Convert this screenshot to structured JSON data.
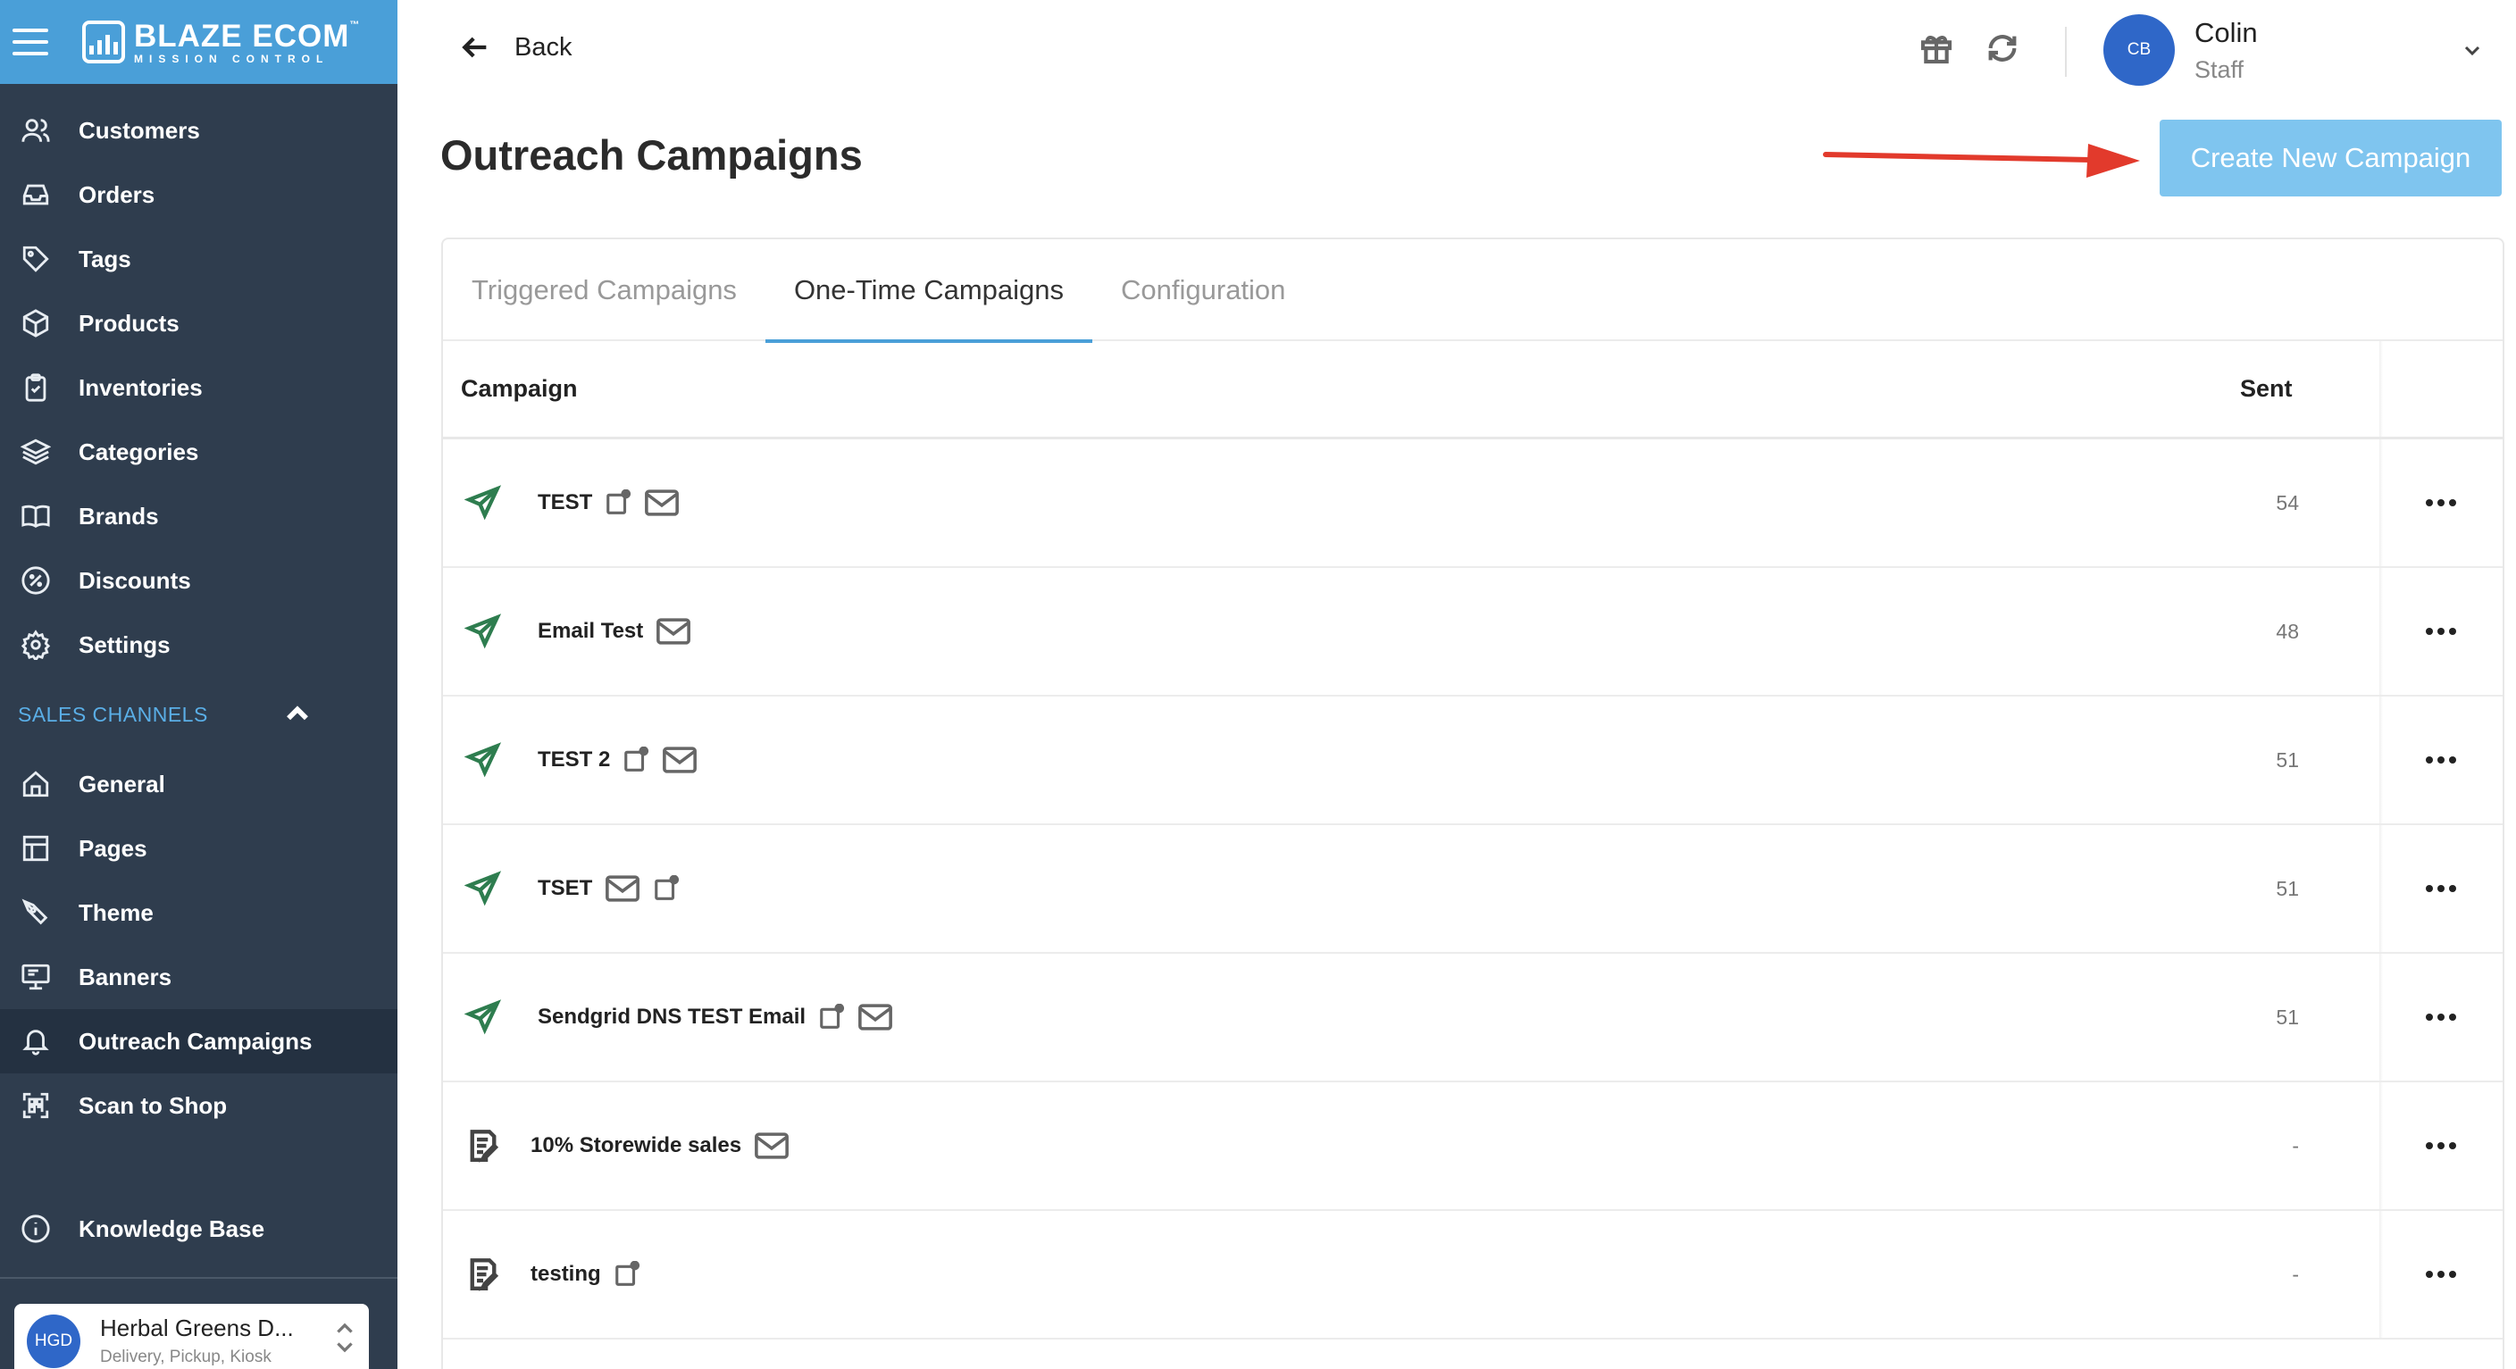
{
  "sidebar": {
    "brand": {
      "title": "BLAZE ECOM",
      "tm": "™",
      "subtitle": "MISSION CONTROL"
    },
    "items": [
      {
        "label": "Customers",
        "icon": "users-icon"
      },
      {
        "label": "Orders",
        "icon": "inbox-icon"
      },
      {
        "label": "Tags",
        "icon": "tag-icon"
      },
      {
        "label": "Products",
        "icon": "box-icon"
      },
      {
        "label": "Inventories",
        "icon": "clipboard-icon"
      },
      {
        "label": "Categories",
        "icon": "layers-icon"
      },
      {
        "label": "Brands",
        "icon": "book-icon"
      },
      {
        "label": "Discounts",
        "icon": "percent-icon"
      },
      {
        "label": "Settings",
        "icon": "gear-icon"
      }
    ],
    "sales_channels_label": "SALES CHANNELS",
    "channel_items": [
      {
        "label": "General",
        "icon": "home-icon"
      },
      {
        "label": "Pages",
        "icon": "layout-icon"
      },
      {
        "label": "Theme",
        "icon": "pen-icon"
      },
      {
        "label": "Banners",
        "icon": "monitor-icon"
      },
      {
        "label": "Outreach Campaigns",
        "icon": "bell-icon",
        "active": true
      },
      {
        "label": "Scan to Shop",
        "icon": "qr-icon"
      }
    ],
    "knowledge_base": "Knowledge Base",
    "store": {
      "initials": "HGD",
      "name": "Herbal Greens D...",
      "types": "Delivery, Pickup, Kiosk"
    }
  },
  "header": {
    "back_label": "Back",
    "user": {
      "initials": "CB",
      "name": "Colin",
      "role": "Staff"
    }
  },
  "page": {
    "title": "Outreach Campaigns",
    "create_button": "Create New Campaign",
    "tabs": [
      {
        "label": "Triggered Campaigns",
        "active": false
      },
      {
        "label": "One-Time Campaigns",
        "active": true
      },
      {
        "label": "Configuration",
        "active": false
      }
    ],
    "columns": {
      "campaign": "Campaign",
      "sent": "Sent"
    },
    "rows": [
      {
        "name": "TEST",
        "status_icon": "send-icon",
        "channels": [
          "push-icon",
          "mail-icon"
        ],
        "sent": "54"
      },
      {
        "name": "Email Test",
        "status_icon": "send-icon",
        "channels": [
          "mail-icon"
        ],
        "sent": "48"
      },
      {
        "name": "TEST 2",
        "status_icon": "send-icon",
        "channels": [
          "push-icon",
          "mail-icon"
        ],
        "sent": "51"
      },
      {
        "name": "TSET",
        "status_icon": "send-icon",
        "channels": [
          "mail-icon",
          "push-icon"
        ],
        "sent": "51"
      },
      {
        "name": "Sendgrid DNS TEST Email",
        "status_icon": "send-icon",
        "channels": [
          "push-icon",
          "mail-icon"
        ],
        "sent": "51"
      },
      {
        "name": "10% Storewide sales",
        "status_icon": "draft-icon",
        "channels": [
          "mail-icon"
        ],
        "sent": "-"
      },
      {
        "name": "testing",
        "status_icon": "draft-icon",
        "channels": [
          "push-icon"
        ],
        "sent": "-"
      }
    ]
  },
  "colors": {
    "sidebar_bg": "#2f3d4e",
    "header_blue": "#4a9fd8",
    "button_bg": "#7fc5ef",
    "avatar_blue": "#2f67c8",
    "sent_icon_green": "#2e7d4f",
    "annotation_arrow": "#e23a2c"
  }
}
